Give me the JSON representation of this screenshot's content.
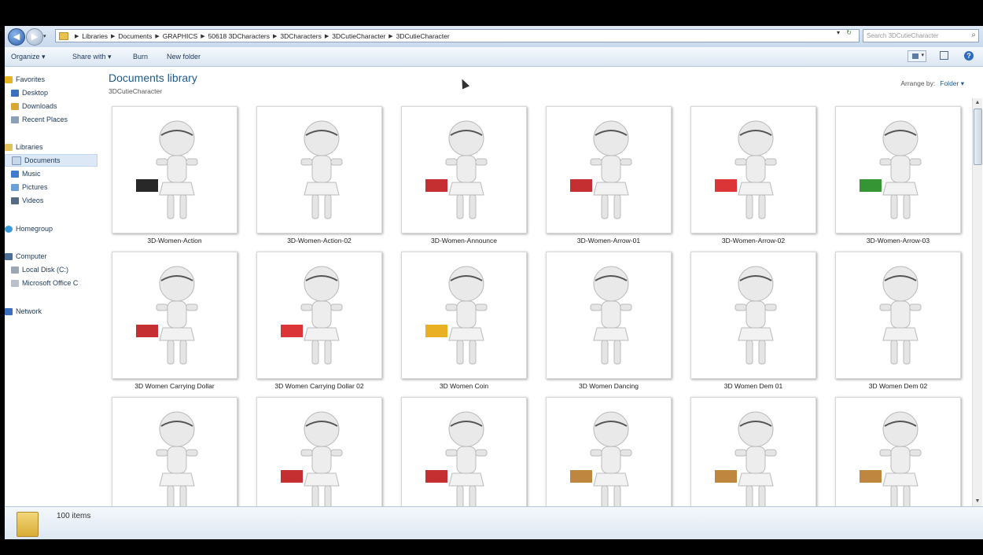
{
  "address": {
    "breadcrumbs": [
      "Libraries",
      "Documents",
      "GRAPHICS",
      "50618 3DCharacters",
      "3DCharacters",
      "3DCutieCharacter",
      "3DCutieCharacter"
    ],
    "search_placeholder": "Search 3DCutieCharacter"
  },
  "toolbar": {
    "organize": "Organize ▾",
    "share": "Share with ▾",
    "burn": "Burn",
    "new_folder": "New folder"
  },
  "nav": {
    "favorites": "Favorites",
    "desktop": "Desktop",
    "downloads": "Downloads",
    "recent": "Recent Places",
    "libraries": "Libraries",
    "documents": "Documents",
    "music": "Music",
    "pictures": "Pictures",
    "videos": "Videos",
    "homegroup": "Homegroup",
    "computer": "Computer",
    "local_disk": "Local Disk (C:)",
    "office": "Microsoft Office C",
    "network": "Network"
  },
  "content": {
    "title": "Documents library",
    "subtitle": "3DCutieCharacter",
    "arrange_label": "Arrange by:",
    "arrange_value": "Folder ▾"
  },
  "files": [
    {
      "name": "3D-Women-Action",
      "accent": "#111111"
    },
    {
      "name": "3D-Women-Action-02",
      "accent": ""
    },
    {
      "name": "3D-Women-Announce",
      "accent": "#c0181b"
    },
    {
      "name": "3D-Women-Arrow-01",
      "accent": "#c0181b"
    },
    {
      "name": "3D-Women-Arrow-02",
      "accent": "#d81f22"
    },
    {
      "name": "3D-Women-Arrow-03",
      "accent": "#1f8a1f"
    },
    {
      "name": "3D Women Carrying Dollar",
      "accent": "#c0181b"
    },
    {
      "name": "3D Women Carrying Dollar 02",
      "accent": "#d81f22"
    },
    {
      "name": "3D Women Coin",
      "accent": "#e8a70c"
    },
    {
      "name": "3D Women Dancing",
      "accent": ""
    },
    {
      "name": "3D Women Dem 01",
      "accent": ""
    },
    {
      "name": "3D Women Dem 02",
      "accent": ""
    },
    {
      "name": "",
      "accent": ""
    },
    {
      "name": "",
      "accent": "#c0181b"
    },
    {
      "name": "",
      "accent": "#c0181b"
    },
    {
      "name": "",
      "accent": "#b8792a"
    },
    {
      "name": "",
      "accent": "#b8792a"
    },
    {
      "name": "",
      "accent": "#b8792a"
    }
  ],
  "details": {
    "count": "100 items"
  }
}
